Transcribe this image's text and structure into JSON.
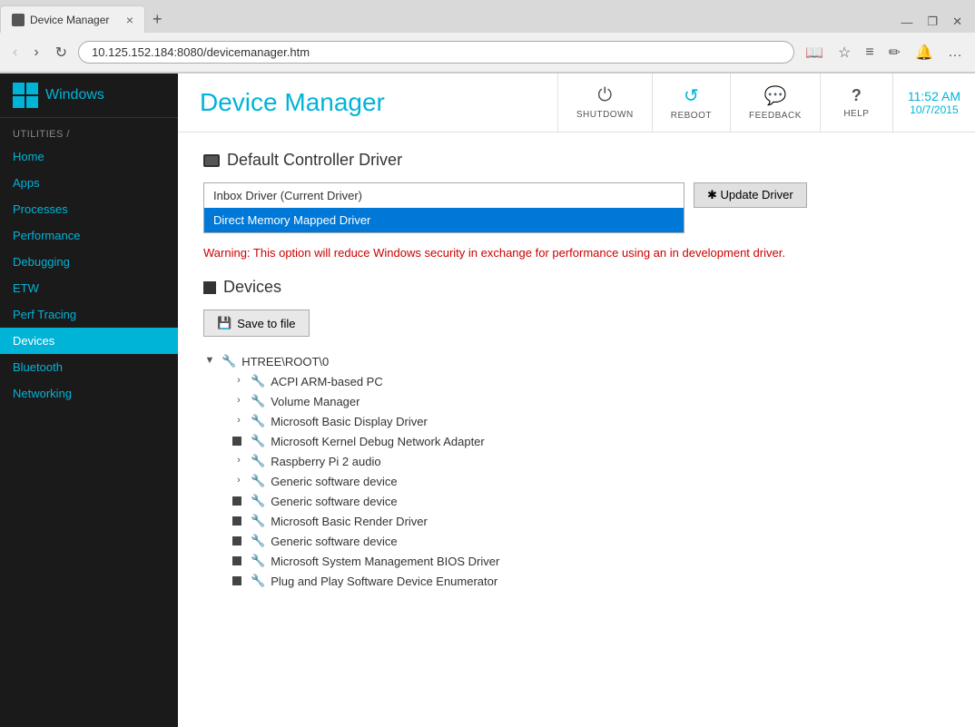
{
  "browser": {
    "tab_title": "Device Manager",
    "tab_close": "×",
    "new_tab": "+",
    "url": "10.125.152.184:8080/devicemanager.htm",
    "back_btn": "‹",
    "forward_btn": "›",
    "refresh_btn": "↻",
    "minimize": "—",
    "maximize": "❐",
    "close": "✕",
    "nav_icons": {
      "book": "📖",
      "star": "☆",
      "menu": "≡",
      "edit": "✎",
      "bell": "🔔",
      "dots": "…"
    }
  },
  "sidebar": {
    "brand": "Windows",
    "section_label": "UTILITIES /",
    "items": [
      {
        "label": "Home",
        "active": false
      },
      {
        "label": "Apps",
        "active": false
      },
      {
        "label": "Processes",
        "active": false
      },
      {
        "label": "Performance",
        "active": false
      },
      {
        "label": "Debugging",
        "active": false
      },
      {
        "label": "ETW",
        "active": false
      },
      {
        "label": "Perf Tracing",
        "active": false
      },
      {
        "label": "Devices",
        "active": true
      },
      {
        "label": "Bluetooth",
        "active": false
      },
      {
        "label": "Networking",
        "active": false
      }
    ]
  },
  "header": {
    "title": "Device Manager",
    "actions": [
      {
        "id": "shutdown",
        "label": "SHUTDOWN",
        "icon": "⏻"
      },
      {
        "id": "reboot",
        "label": "REBOOT",
        "icon": "↺"
      },
      {
        "id": "feedback",
        "label": "FEEDBACK",
        "icon": "💬"
      },
      {
        "id": "help",
        "label": "HELP",
        "icon": "?"
      }
    ],
    "time": "11:52 AM",
    "date": "10/7/2015"
  },
  "default_controller": {
    "section_title": "Default Controller Driver",
    "drivers": [
      {
        "label": "Inbox Driver (Current Driver)",
        "selected": false
      },
      {
        "label": "Direct Memory Mapped Driver",
        "selected": true
      }
    ],
    "update_btn_label": "✱ Update Driver",
    "warning": "Warning: This option will reduce Windows security in exchange for performance using an in development driver."
  },
  "devices": {
    "section_title": "Devices",
    "save_btn_label": "Save to file",
    "save_icon": "💾",
    "tree": {
      "root_label": "HTREE\\ROOT\\0",
      "children": [
        {
          "label": "ACPI ARM-based PC",
          "expanded": false,
          "square": false
        },
        {
          "label": "Volume Manager",
          "expanded": false,
          "square": false
        },
        {
          "label": "Microsoft Basic Display Driver",
          "expanded": false,
          "square": false
        },
        {
          "label": "Microsoft Kernel Debug Network Adapter",
          "expanded": false,
          "square": true
        },
        {
          "label": "Raspberry Pi 2 audio",
          "expanded": false,
          "square": false
        },
        {
          "label": "Generic software device",
          "expanded": false,
          "square": false
        },
        {
          "label": "Generic software device",
          "expanded": false,
          "square": true
        },
        {
          "label": "Microsoft Basic Render Driver",
          "expanded": false,
          "square": true
        },
        {
          "label": "Generic software device",
          "expanded": false,
          "square": true
        },
        {
          "label": "Microsoft System Management BIOS Driver",
          "expanded": false,
          "square": true
        },
        {
          "label": "Plug and Play Software Device Enumerator",
          "expanded": false,
          "square": true
        }
      ]
    }
  }
}
